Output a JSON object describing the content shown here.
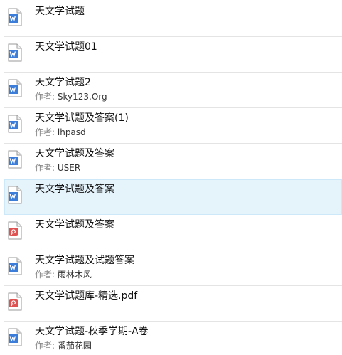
{
  "author_label": "作者:",
  "colors": {
    "word_icon": "#3b7dd8",
    "pdf_icon": "#e05252",
    "selected_bg": "#e5f3fb"
  },
  "files": [
    {
      "title": "天文学试题",
      "author": "",
      "icon": "word-icon"
    },
    {
      "title": "天文学试题01",
      "author": "",
      "icon": "word-icon"
    },
    {
      "title": "天文学试题2",
      "author": "Sky123.Org",
      "icon": "word-icon"
    },
    {
      "title": "天文学试题及答案(1)",
      "author": "lhpasd",
      "icon": "word-icon"
    },
    {
      "title": "天文学试题及答案",
      "author": "USER",
      "icon": "word-icon"
    },
    {
      "title": "天文学试题及答案",
      "author": "",
      "icon": "word-icon",
      "selected": true
    },
    {
      "title": "天文学试题及答案",
      "author": "",
      "icon": "pdf-icon"
    },
    {
      "title": "天文学试题及试题答案",
      "author": "雨林木风",
      "icon": "word-icon"
    },
    {
      "title": "天文学试题库-精选.pdf",
      "author": "",
      "icon": "pdf-icon"
    },
    {
      "title": "天文学试题-秋季学期-A卷",
      "author": "番茄花园",
      "icon": "word-icon"
    }
  ]
}
